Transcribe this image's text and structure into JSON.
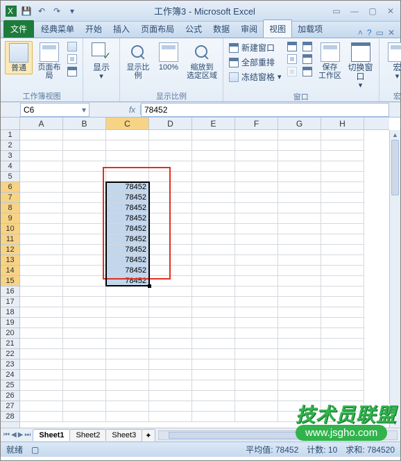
{
  "title": "工作簿3 - Microsoft Excel",
  "tabs": {
    "file": "文件",
    "items": [
      "经典菜单",
      "开始",
      "插入",
      "页面布局",
      "公式",
      "数据",
      "审阅",
      "视图",
      "加载项"
    ],
    "active_index": 7
  },
  "ribbon": {
    "group1_label": "工作簿视图",
    "normal": "普通",
    "pagelayout": "页面布局",
    "group2_label": "显示",
    "show": "显示",
    "group3_label": "显示比例",
    "zoom": "显示比例",
    "hundred": "100%",
    "zoomsel": "缩放到\n选定区域",
    "group4_label": "窗口",
    "newwin": "新建窗口",
    "arrange": "全部重排",
    "freeze": "冻结窗格",
    "save_ws": "保存\n工作区",
    "switch": "切换窗口",
    "group5_label": "宏",
    "macro": "宏"
  },
  "namebox": "C6",
  "formula": "78452",
  "columns": [
    "A",
    "B",
    "C",
    "D",
    "E",
    "F",
    "G",
    "H"
  ],
  "rows": [
    "1",
    "2",
    "3",
    "4",
    "5",
    "6",
    "7",
    "8",
    "9",
    "10",
    "11",
    "12",
    "13",
    "14",
    "15",
    "16",
    "17",
    "18",
    "19",
    "20",
    "21",
    "22",
    "23",
    "24",
    "25",
    "26",
    "27",
    "28"
  ],
  "cell_value": "78452",
  "sheet_tabs": [
    "Sheet1",
    "Sheet2",
    "Sheet3"
  ],
  "active_sheet": 0,
  "status": {
    "ready": "就绪",
    "avg": "平均值: 78452",
    "count": "计数: 10",
    "sum": "求和: 784520"
  },
  "watermark": {
    "top": "技术员联盟",
    "bottom": "www.jsgho.com"
  }
}
